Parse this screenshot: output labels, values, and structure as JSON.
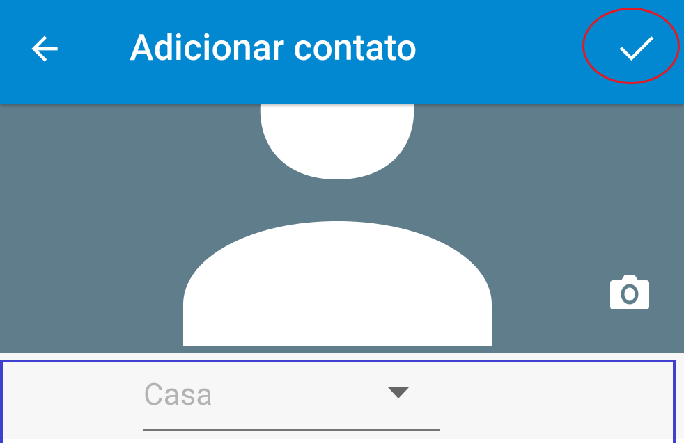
{
  "colors": {
    "appbar": "#0288d1",
    "appbar_text": "#ffffff",
    "photo_background": "#607d8b",
    "avatar_silhouette": "#ffffff",
    "form_background": "#f7f7f7",
    "annotation_red": "#e01b24",
    "annotation_blue": "#3f3fd0",
    "select_placeholder": "#b3b3b3",
    "select_underline": "#757575"
  },
  "toolbar": {
    "title": "Adicionar contato",
    "back_icon": "arrow-back-icon",
    "confirm_icon": "check-icon"
  },
  "photo": {
    "placeholder_icon": "person-silhouette-icon",
    "camera_icon": "camera-icon"
  },
  "form": {
    "phone_type": {
      "value": "Casa",
      "icon": "arrow-drop-down-icon"
    }
  }
}
